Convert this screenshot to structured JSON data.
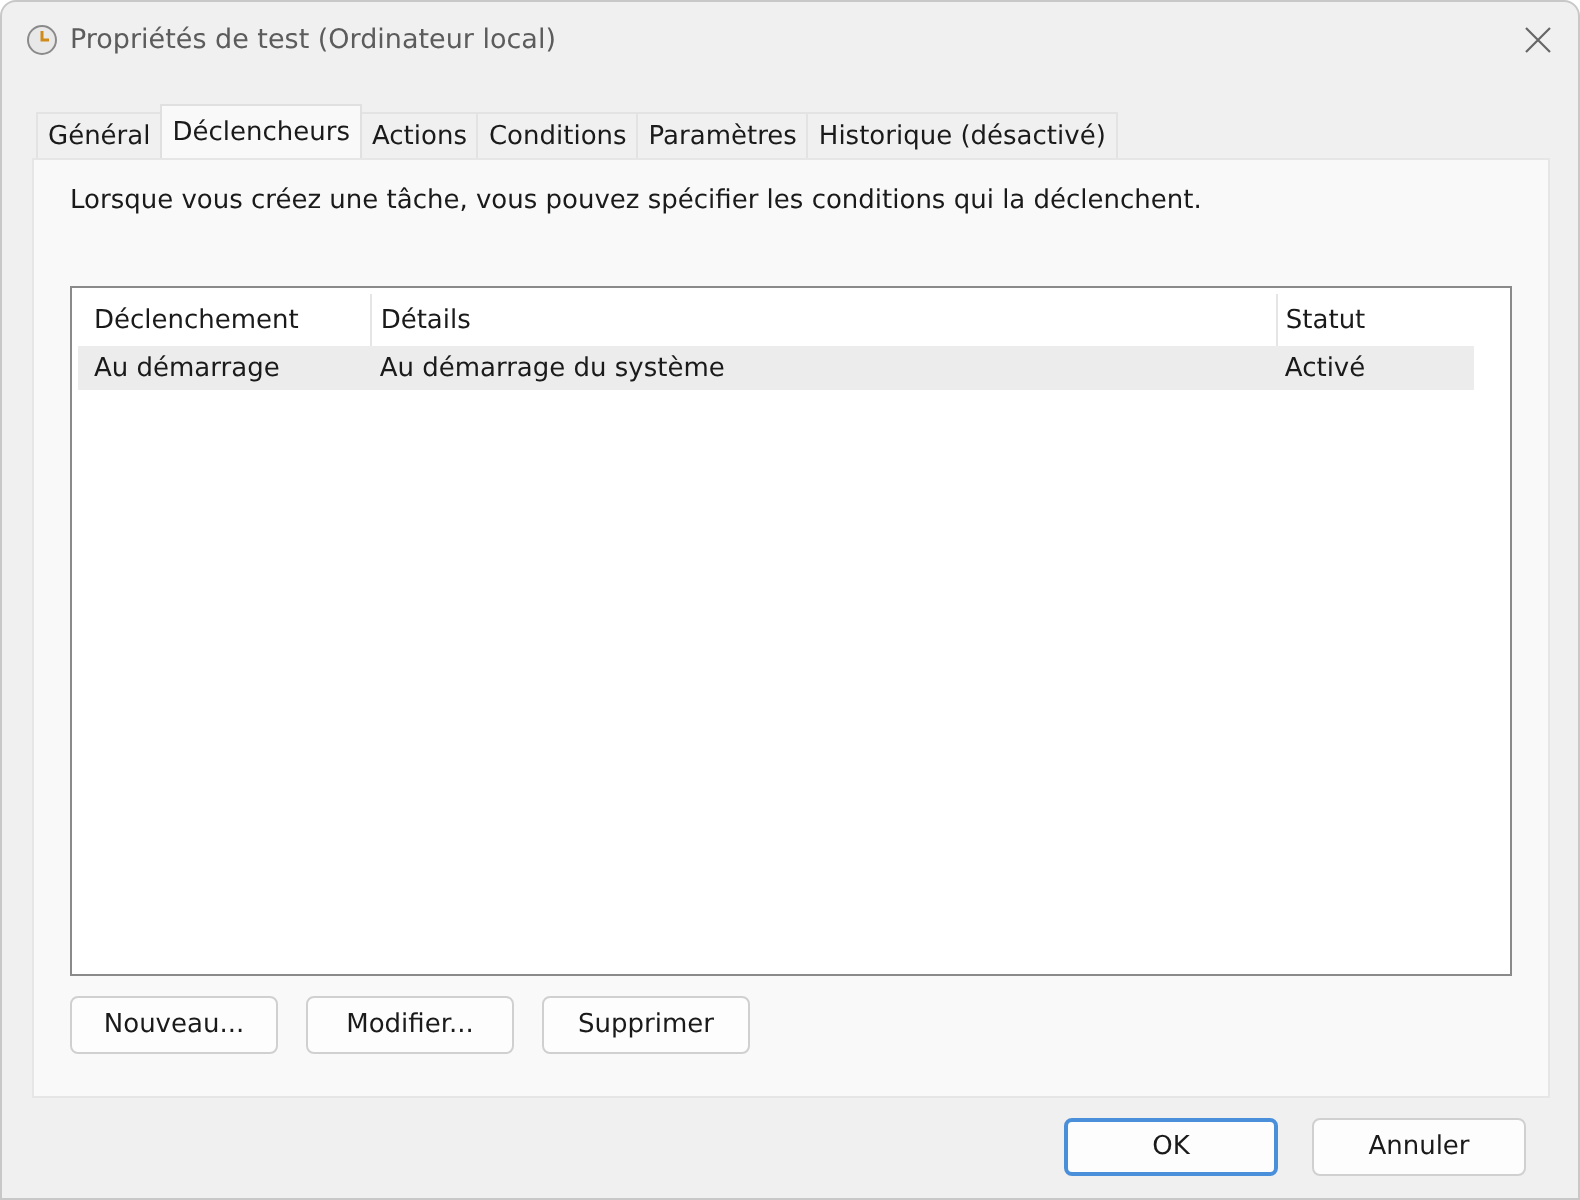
{
  "window": {
    "title": "Propriétés de test (Ordinateur local)"
  },
  "tabs": [
    {
      "label": "Général",
      "selected": false
    },
    {
      "label": "Déclencheurs",
      "selected": true
    },
    {
      "label": "Actions",
      "selected": false
    },
    {
      "label": "Conditions",
      "selected": false
    },
    {
      "label": "Paramètres",
      "selected": false
    },
    {
      "label": "Historique (désactivé)",
      "selected": false
    }
  ],
  "description": "Lorsque vous créez une tâche, vous pouvez spécifier les conditions qui la déclenchent.",
  "table": {
    "columns": [
      "Déclenchement",
      "Détails",
      "Statut"
    ],
    "rows": [
      {
        "cells": [
          "Au démarrage",
          "Au démarrage du système",
          "Activé"
        ],
        "selected": true
      }
    ]
  },
  "list_buttons": [
    "Nouveau...",
    "Modifier...",
    "Supprimer"
  ],
  "dialog_buttons": [
    {
      "label": "OK",
      "default": true
    },
    {
      "label": "Annuler",
      "default": false
    }
  ]
}
